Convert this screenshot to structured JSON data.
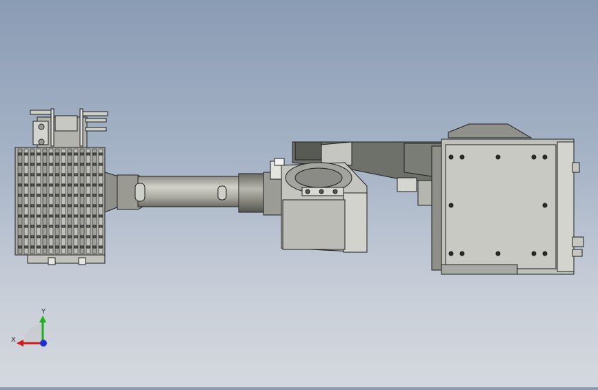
{
  "viewport": {
    "background_top": "#8a9bb4",
    "background_bottom": "#d4d8de"
  },
  "model": {
    "body_color": "#b9b9b3",
    "dark_color": "#6e706a",
    "edge_color": "#1e1e1e",
    "plate_color": "#c8c8c3"
  },
  "triad": {
    "x_label": "X",
    "y_label": "Y",
    "x_color": "#d11a1a",
    "y_color": "#19b219",
    "z_color": "#1f2fd6"
  }
}
